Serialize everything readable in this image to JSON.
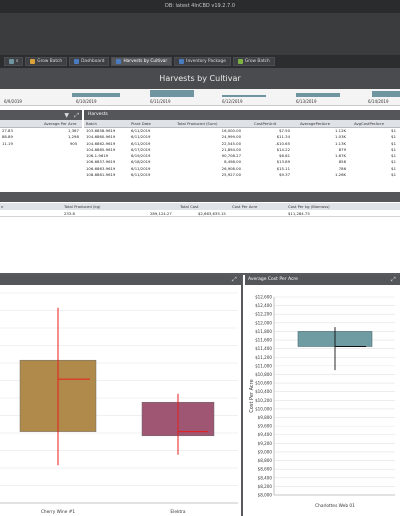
{
  "app": {
    "title": "DB: latest   4InCBD v19.2.7.0"
  },
  "tabs": [
    {
      "label": "s",
      "color": "#6e95a0",
      "active": false
    },
    {
      "label": "Grow Batch",
      "color": "#d9a23b",
      "active": false
    },
    {
      "label": "Dashboard",
      "color": "#4b7bbf",
      "active": false
    },
    {
      "label": "Harvests by Cultivar",
      "color": "#4b7bbf",
      "active": true
    },
    {
      "label": "Inventory Package",
      "color": "#4b7bbf",
      "active": false
    },
    {
      "label": "Grow Batch",
      "color": "#7cb342",
      "active": false
    }
  ],
  "report": {
    "title": "Harvests by Cultivar"
  },
  "timeline": {
    "dates": [
      "6/9/2019",
      "6/10/2019",
      "6/11/2019",
      "6/12/2019",
      "6/13/2019",
      "6/14/2019"
    ]
  },
  "left_grid": {
    "header": "Average Per Acre (kg)",
    "rows": [
      {
        "a": "27.83",
        "b": "1,367"
      },
      {
        "a": "88.89",
        "b": "1,298"
      },
      {
        "a": "11.19",
        "b": "905"
      }
    ]
  },
  "harvests": {
    "title": "Harvests",
    "columns": [
      "Batch",
      "Plant Date",
      "Total Produced (Sum)",
      "CostPerUnit",
      "AveragePerAcre",
      "AvgCostPerAcre"
    ],
    "rows": [
      [
        "103-6858-9619",
        "6/11/2019",
        "16,000.00",
        "$7.50",
        "1.12K",
        "$1"
      ],
      [
        "104-6860-9619",
        "6/11/2019",
        "24,999.00",
        "$11.34",
        "1.03K",
        "$1"
      ],
      [
        "104-6862-9619",
        "6/11/2019",
        "22,545.00",
        "-$10.65",
        "1.13K",
        "$1"
      ],
      [
        "104-6865-9619",
        "6/17/2019",
        "21,894.00",
        "$14.22",
        "879",
        "$1"
      ],
      [
        "106-1-9619",
        "6/19/2019",
        "90,708.27",
        "$6.61",
        "1.67K",
        "$1"
      ],
      [
        "106-6857-9619",
        "6/18/2019",
        "8,498.00",
        "$13.89",
        "858",
        "$1"
      ],
      [
        "106-6863-9619",
        "6/11/2019",
        "26,908.00",
        "$15.11",
        "786",
        "$1"
      ],
      [
        "108-6861-9619",
        "6/11/2019",
        "25,927.00",
        "$9.37",
        "1.26K",
        "$1"
      ]
    ]
  },
  "summary": {
    "columns": [
      "n",
      "Total Produced (kg)",
      "Total Cost",
      "Cost Per Acre",
      "Cost Per kg (Biomass)"
    ],
    "values": [
      "",
      "233.8",
      "289,124.27",
      "$2,663,635.15",
      "$11,284.75"
    ]
  },
  "chart_left": {
    "x_labels": [
      "Cherry Wine #1",
      "Elektra"
    ]
  },
  "chart_right": {
    "title": "Average Cost Per Acre",
    "ylabel": "Cost Per Acre",
    "x_label": "Charlottes Web 01",
    "ticks": [
      "$12,600",
      "$12,400",
      "$12,200",
      "$12,000",
      "$11,800",
      "$11,600",
      "$11,400",
      "$11,200",
      "$11,000",
      "$10,800",
      "$10,600",
      "$10,400",
      "$10,200",
      "$10,000",
      "$9,800",
      "$9,600",
      "$9,400",
      "$9,200",
      "$9,000",
      "$8,800",
      "$8,600",
      "$8,400",
      "$8,200",
      "$8,000"
    ]
  },
  "chart_data": [
    {
      "type": "box",
      "title": "",
      "xlabel": "",
      "ylabel": "",
      "categories": [
        "Cherry Wine #1",
        "Elektra"
      ],
      "series": [
        {
          "color": "#b08a4a",
          "whisker_low": 0.18,
          "q1": 0.34,
          "median": 0.59,
          "q3": 0.68,
          "whisker_high": 0.93
        },
        {
          "color": "#9e5672",
          "whisker_low": 0.23,
          "q1": 0.32,
          "median": 0.34,
          "q3": 0.48,
          "whisker_high": 0.52
        }
      ]
    },
    {
      "type": "box",
      "title": "Average Cost Per Acre",
      "ylabel": "Cost Per Acre",
      "categories": [
        "Charlottes Web 01"
      ],
      "ylim": [
        8000,
        12600
      ],
      "series": [
        {
          "color": "#6f9ba3",
          "whisker_low": 10900,
          "q1": 11450,
          "median": 11450,
          "q3": 11800,
          "whisker_high": 11900
        }
      ]
    }
  ]
}
